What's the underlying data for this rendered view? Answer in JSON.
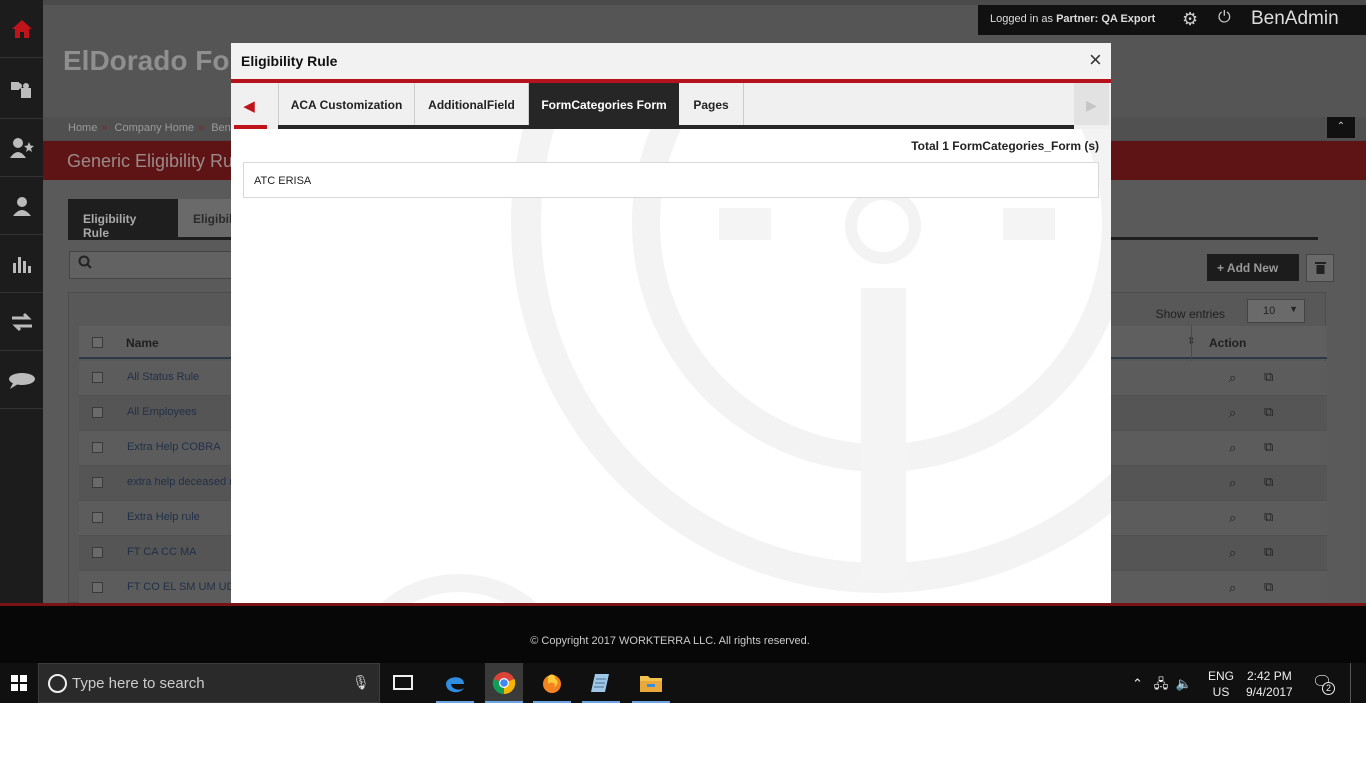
{
  "app": {
    "title": "ElDorado Fo",
    "breadcrumbs": [
      "Home",
      "»",
      "Company Home",
      "»",
      "BenA"
    ],
    "page_heading": "Generic Eligibility Ru"
  },
  "topbar": {
    "logged_in_prefix": "Logged in as",
    "role": "Partner:",
    "account": "QA Export",
    "brand": "BenAdmin"
  },
  "page_tabs": [
    "Eligibility Rule",
    "Eligibil"
  ],
  "search": {
    "placeholder": ""
  },
  "toolbar": {
    "add_new": "+  Add New"
  },
  "grid": {
    "show_entries_label": "Show entries",
    "page_size": "10",
    "columns": {
      "name": "Name",
      "action": "Action"
    },
    "rows": [
      "All Status Rule",
      "All Employees",
      "Extra Help COBRA",
      "extra help deceased r",
      "Extra Help rule",
      "FT CA CC MA",
      "FT CO EL SM UM UD"
    ]
  },
  "modal": {
    "title": "Eligibility Rule",
    "close_glyph": "×",
    "tabs": [
      {
        "label": "ACA Customization",
        "active": false
      },
      {
        "label": "AdditionalField",
        "active": false
      },
      {
        "label": "FormCategories Form",
        "active": true
      },
      {
        "label": "Pages",
        "active": false
      }
    ],
    "total_text": "Total 1 FormCategories_Form (s)",
    "items": [
      "ATC ERISA"
    ]
  },
  "footer": {
    "copyright": "© Copyright 2017 WORKTERRA LLC. All rights reserved."
  },
  "taskbar": {
    "search_placeholder": "Type here to search",
    "lang_top": "ENG",
    "lang_bottom": "US",
    "time": "2:42 PM",
    "date": "9/4/2017",
    "notification_count": "2"
  },
  "colors": {
    "accent_red": "#b5121b",
    "active_tab": "#262626",
    "link_blue": "#213048"
  },
  "icons": [
    "home-icon",
    "puzzle-icon",
    "user-star-icon",
    "user-icon",
    "bar-chart-icon",
    "transfer-icon",
    "chat-icon",
    "gear-icon",
    "power-icon",
    "search-icon",
    "trash-icon",
    "view-icon",
    "copy-icon",
    "close-icon",
    "chevron-left-icon",
    "chevron-right-icon",
    "windows-icon",
    "cortana-icon",
    "mic-icon",
    "task-view-icon",
    "edge-icon",
    "chrome-icon",
    "firefox-icon",
    "notepad-icon",
    "file-explorer-icon",
    "notification-icon"
  ]
}
